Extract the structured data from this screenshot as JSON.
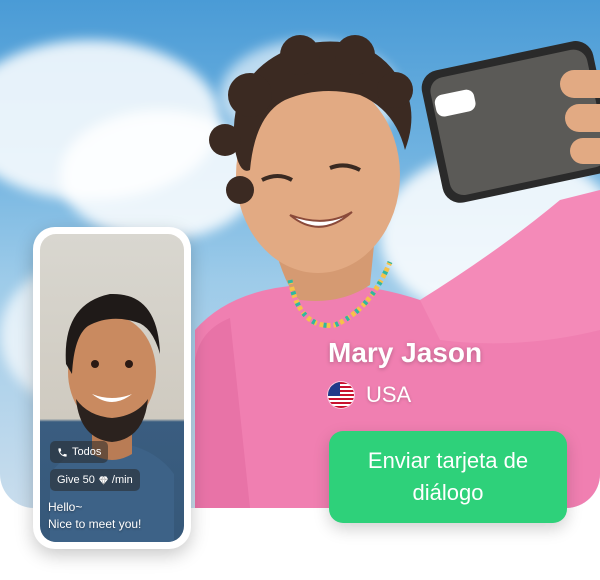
{
  "profile": {
    "name": "Mary Jason",
    "country": "USA",
    "flag_icon": "us-flag-icon"
  },
  "cta": {
    "label": "Enviar tarjeta de diálogo",
    "color": "#2ed17a"
  },
  "phone": {
    "filter_label": "Todos",
    "rate_prefix": "Give 50",
    "rate_suffix": "/min",
    "phone_icon": "phone-icon",
    "gem_icon": "diamond-icon",
    "message_line1": "Hello~",
    "message_line2": "Nice to meet you!"
  }
}
